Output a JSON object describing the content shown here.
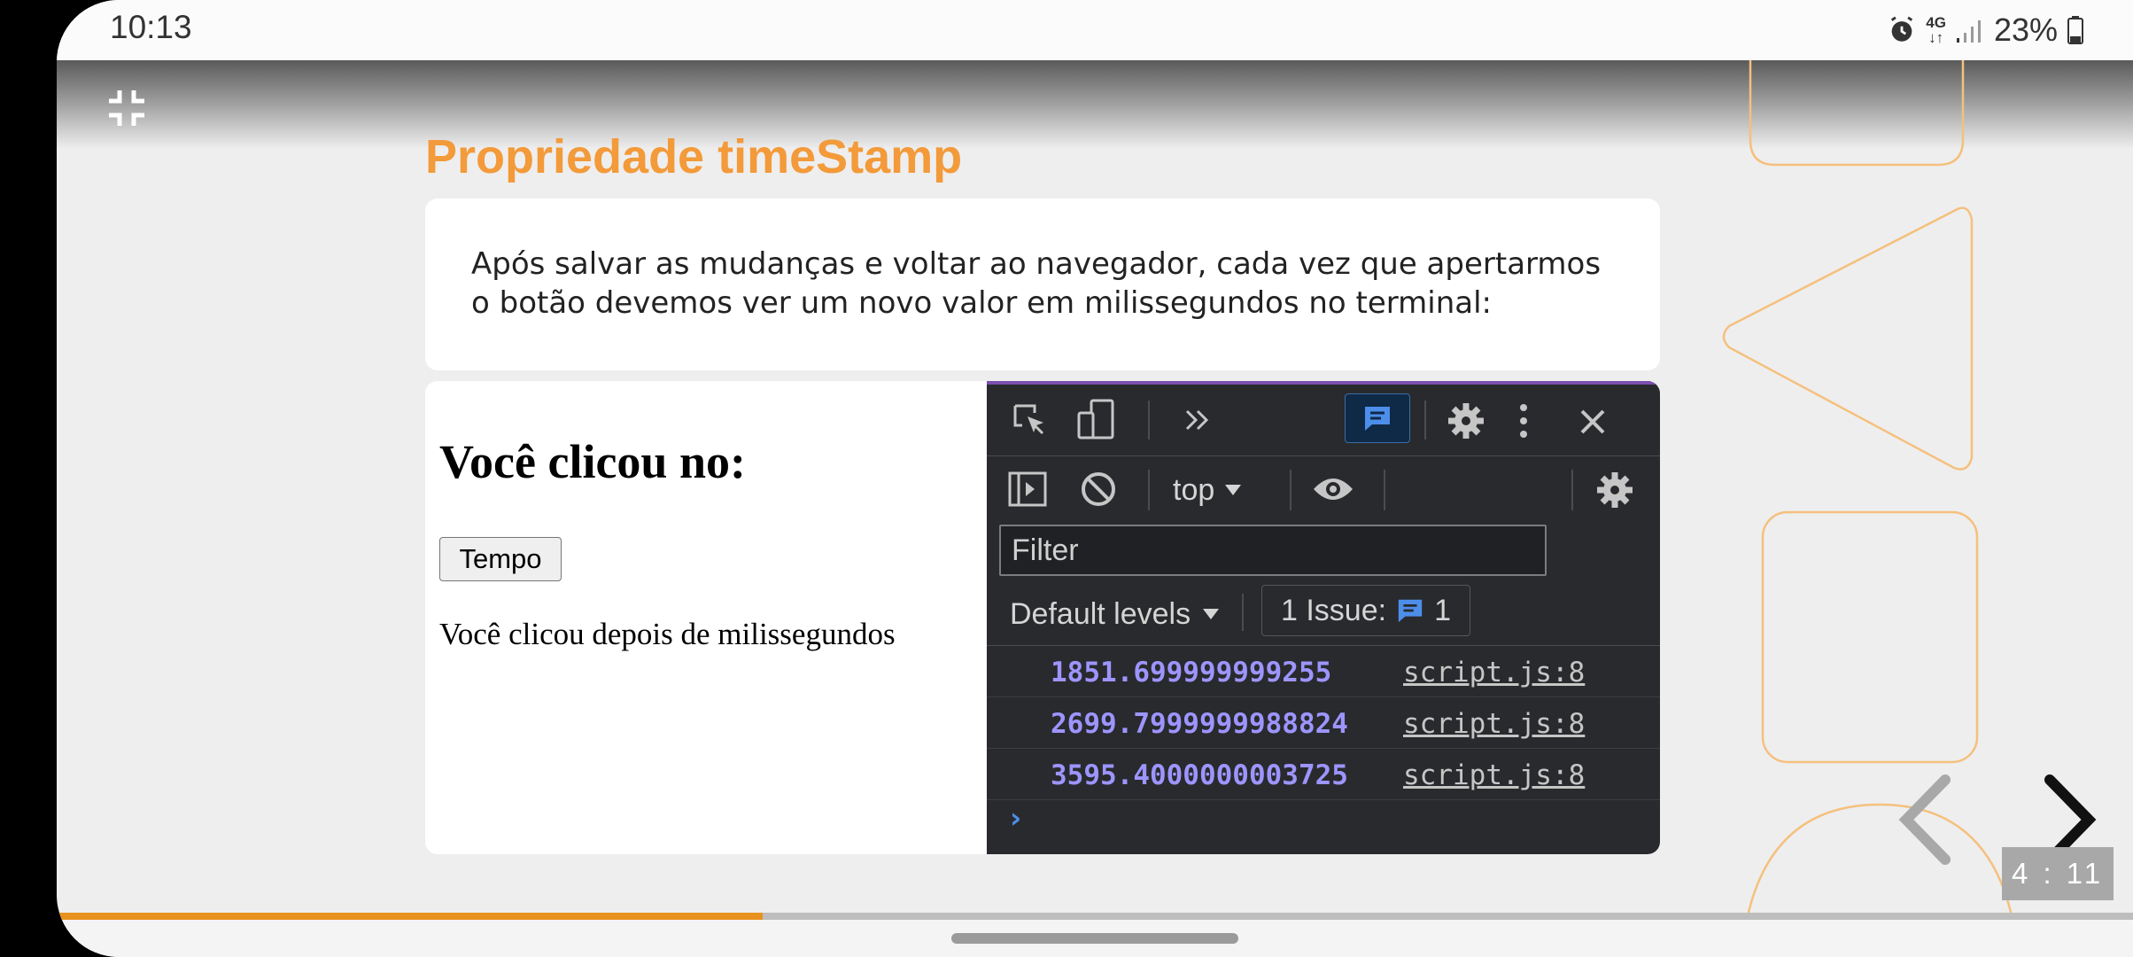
{
  "status_bar": {
    "time": "10:13",
    "network": "4G",
    "battery": "23%"
  },
  "slide": {
    "title": "Propriedade timeStamp",
    "description": "Após salvar as mudanças e voltar ao navegador, cada vez que apertarmos o botão devemos ver um novo valor em milissegundos no terminal:",
    "page_indicator": "4 : 11",
    "progress": 0.34
  },
  "demo_page": {
    "heading": "Você clicou no:",
    "button_label": "Tempo",
    "result_text": "Você clicou depois de milissegundos"
  },
  "devtools": {
    "context": "top",
    "filter_placeholder": "Filter",
    "levels": "Default levels",
    "issues_label": "1 Issue:",
    "issues_count": "1",
    "logs": [
      {
        "value": "1851.699999999255",
        "source": "script.js:8"
      },
      {
        "value": "2699.7999999988824",
        "source": "script.js:8"
      },
      {
        "value": "3595.4000000003725",
        "source": "script.js:8"
      }
    ],
    "accent": "#9d95ff"
  },
  "colors": {
    "title_orange": "#f39a3a",
    "progress_orange": "#e8911e",
    "devtools_bg": "#292a2d"
  }
}
